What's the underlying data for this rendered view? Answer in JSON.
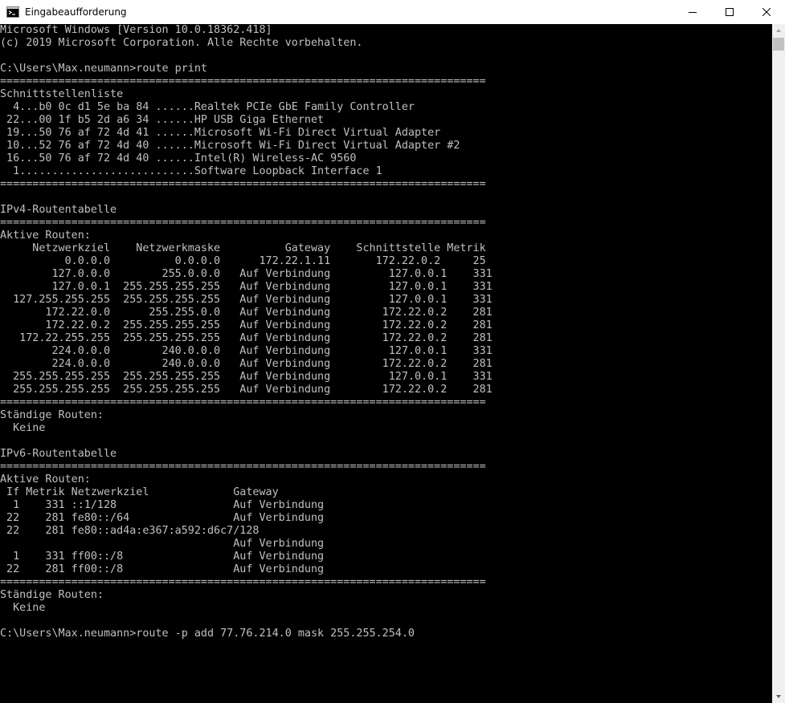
{
  "window": {
    "title": "Eingabeaufforderung",
    "icon": "cmd-icon",
    "controls": [
      "minimize-icon",
      "maximize-icon",
      "close-icon"
    ]
  },
  "colors": {
    "console_bg": "#000000",
    "console_fg": "#c0c0c0",
    "titlebar_bg": "#ffffff",
    "scrollbar_bg": "#f0f0f0",
    "scrollbar_thumb": "#c1c1c1"
  },
  "console": {
    "lines": [
      "Microsoft Windows [Version 10.0.18362.418]",
      "(c) 2019 Microsoft Corporation. Alle Rechte vorbehalten.",
      "",
      "C:\\Users\\Max.neumann>route print",
      "===========================================================================",
      "Schnittstellenliste",
      "  4...b0 0c d1 5e ba 84 ......Realtek PCIe GbE Family Controller",
      " 22...00 1f b5 2d a6 34 ......HP USB Giga Ethernet",
      " 19...50 76 af 72 4d 41 ......Microsoft Wi-Fi Direct Virtual Adapter",
      " 10...52 76 af 72 4d 40 ......Microsoft Wi-Fi Direct Virtual Adapter #2",
      " 16...50 76 af 72 4d 40 ......Intel(R) Wireless-AC 9560",
      "  1...........................Software Loopback Interface 1",
      "===========================================================================",
      "",
      "IPv4-Routentabelle",
      "===========================================================================",
      "Aktive Routen:",
      "     Netzwerkziel    Netzwerkmaske          Gateway    Schnittstelle Metrik",
      "          0.0.0.0          0.0.0.0      172.22.1.11       172.22.0.2     25",
      "        127.0.0.0        255.0.0.0   Auf Verbindung         127.0.0.1    331",
      "        127.0.0.1  255.255.255.255   Auf Verbindung         127.0.0.1    331",
      "  127.255.255.255  255.255.255.255   Auf Verbindung         127.0.0.1    331",
      "       172.22.0.0      255.255.0.0   Auf Verbindung        172.22.0.2    281",
      "       172.22.0.2  255.255.255.255   Auf Verbindung        172.22.0.2    281",
      "   172.22.255.255  255.255.255.255   Auf Verbindung        172.22.0.2    281",
      "        224.0.0.0        240.0.0.0   Auf Verbindung         127.0.0.1    331",
      "        224.0.0.0        240.0.0.0   Auf Verbindung        172.22.0.2    281",
      "  255.255.255.255  255.255.255.255   Auf Verbindung         127.0.0.1    331",
      "  255.255.255.255  255.255.255.255   Auf Verbindung        172.22.0.2    281",
      "===========================================================================",
      "Ständige Routen:",
      "  Keine",
      "",
      "IPv6-Routentabelle",
      "===========================================================================",
      "Aktive Routen:",
      " If Metrik Netzwerkziel             Gateway",
      "  1    331 ::1/128                  Auf Verbindung",
      " 22    281 fe80::/64                Auf Verbindung",
      " 22    281 fe80::ad4a:e367:a592:d6c7/128",
      "                                    Auf Verbindung",
      "  1    331 ff00::/8                 Auf Verbindung",
      " 22    281 ff00::/8                 Auf Verbindung",
      "===========================================================================",
      "Ständige Routen:",
      "  Keine",
      "",
      "C:\\Users\\Max.neumann>route -p add 77.76.214.0 mask 255.255.254.0"
    ]
  }
}
